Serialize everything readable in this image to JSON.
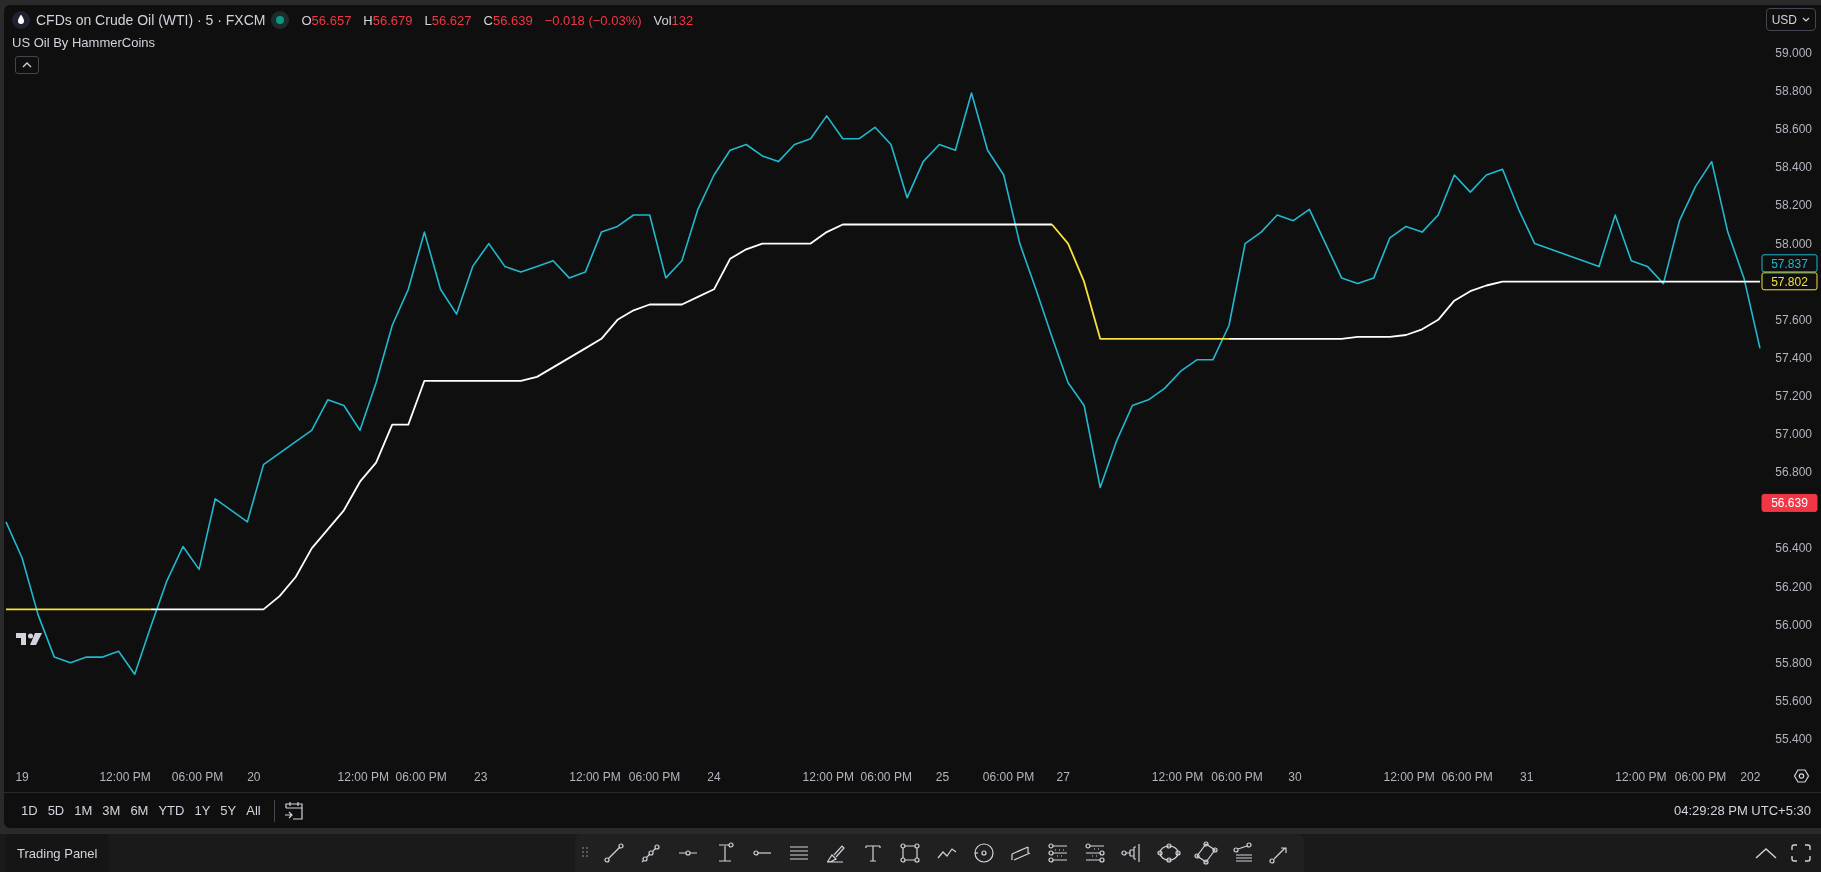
{
  "legend": {
    "title": "CFDs on Crude Oil (WTI) · 5 · FXCM",
    "market_open": true,
    "ohlc": [
      {
        "label": "O",
        "value": "56.657"
      },
      {
        "label": "H",
        "value": "56.679"
      },
      {
        "label": "L",
        "value": "56.627"
      },
      {
        "label": "C",
        "value": "56.639"
      }
    ],
    "change": "−0.018 (−0.03%)",
    "volume_label": "Vol",
    "volume": "132",
    "indicator": "US Oil By HammerCoins",
    "collapsed": false
  },
  "currency": "USD",
  "chart": {
    "chart_data": {
      "type": "line",
      "ylim": [
        55.4,
        59.0
      ],
      "yticks": [
        {
          "value": 59.0,
          "label": "59.000"
        },
        {
          "value": 58.8,
          "label": "58.800"
        },
        {
          "value": 58.6,
          "label": "58.600"
        },
        {
          "value": 58.4,
          "label": "58.400"
        },
        {
          "value": 58.2,
          "label": "58.200"
        },
        {
          "value": 58.0,
          "label": "58.000"
        },
        {
          "value": 57.6,
          "label": "57.600"
        },
        {
          "value": 57.4,
          "label": "57.400"
        },
        {
          "value": 57.2,
          "label": "57.200"
        },
        {
          "value": 57.0,
          "label": "57.000"
        },
        {
          "value": 56.8,
          "label": "56.800"
        },
        {
          "value": 56.4,
          "label": "56.400"
        },
        {
          "value": 56.2,
          "label": "56.200"
        },
        {
          "value": 56.0,
          "label": "56.000"
        },
        {
          "value": 55.8,
          "label": "55.800"
        },
        {
          "value": 55.6,
          "label": "55.600"
        },
        {
          "value": 55.4,
          "label": "55.400"
        }
      ],
      "series": [
        {
          "color": "#22b8cf",
          "values": [
            56.54,
            56.35,
            56.05,
            55.83,
            55.8,
            55.83,
            55.83,
            55.86,
            55.74,
            55.99,
            56.23,
            56.41,
            56.29,
            56.66,
            56.6,
            56.54,
            56.84,
            56.9,
            56.96,
            57.02,
            57.18,
            57.15,
            57.02,
            57.27,
            57.57,
            57.76,
            58.06,
            57.76,
            57.63,
            57.88,
            58.0,
            57.88,
            57.85,
            57.88,
            57.91,
            57.82,
            57.85,
            58.06,
            58.09,
            58.15,
            58.15,
            57.82,
            57.91,
            58.18,
            58.36,
            58.49,
            58.52,
            58.46,
            58.43,
            58.52,
            58.55,
            58.67,
            58.55,
            58.55,
            58.61,
            58.52,
            58.24,
            58.43,
            58.52,
            58.49,
            58.79,
            58.49,
            58.36,
            58.0,
            57.76,
            57.51,
            57.27,
            57.15,
            56.72,
            56.96,
            57.15,
            57.18,
            57.24,
            57.33,
            57.39,
            57.39,
            57.57,
            58.0,
            58.06,
            58.15,
            58.12,
            58.18,
            58.0,
            57.82,
            57.79,
            57.82,
            58.03,
            58.09,
            58.06,
            58.15,
            58.36,
            58.27,
            58.36,
            58.39,
            58.18,
            58.0,
            57.97,
            57.94,
            57.91,
            57.88,
            58.15,
            57.91,
            57.88,
            57.79,
            58.12,
            58.3,
            58.43,
            58.06,
            57.82,
            57.45
          ]
        },
        {
          "color": "#ffffff",
          "values": [
            null,
            null,
            null,
            null,
            null,
            null,
            null,
            null,
            null,
            56.08,
            56.08,
            56.08,
            56.08,
            56.08,
            56.08,
            56.08,
            56.08,
            56.15,
            56.25,
            56.4,
            56.5,
            56.6,
            56.75,
            56.85,
            57.05,
            57.05,
            57.28,
            57.28,
            57.28,
            57.28,
            57.28,
            57.28,
            57.28,
            57.3,
            57.35,
            57.4,
            57.45,
            57.5,
            57.6,
            57.65,
            57.68,
            57.68,
            57.68,
            57.72,
            57.76,
            57.92,
            57.97,
            58.0,
            58.0,
            58.0,
            58.0,
            58.06,
            58.1,
            58.1,
            58.1,
            58.1,
            58.1,
            58.1,
            58.1,
            58.1,
            58.1,
            58.1,
            58.1,
            58.1,
            58.1,
            58.1,
            null,
            null,
            null,
            null,
            null,
            null,
            null,
            null,
            null,
            null,
            57.5,
            57.5,
            57.5,
            57.5,
            57.5,
            57.5,
            57.5,
            57.5,
            57.51,
            57.51,
            57.51,
            57.52,
            57.55,
            57.6,
            57.7,
            57.75,
            57.78,
            57.8,
            57.8,
            57.8,
            57.8,
            57.8,
            57.8,
            57.8,
            57.8,
            57.8,
            57.8,
            57.8,
            57.8,
            57.8,
            57.8,
            57.8,
            57.8,
            57.8
          ]
        },
        {
          "color": "#f5e13a",
          "values": [
            56.08,
            56.08,
            56.08,
            56.08,
            56.08,
            56.08,
            56.08,
            56.08,
            56.08,
            56.08,
            null,
            null,
            null,
            null,
            null,
            null,
            null,
            null,
            null,
            null,
            null,
            null,
            null,
            null,
            null,
            null,
            null,
            null,
            null,
            null,
            null,
            null,
            null,
            null,
            null,
            null,
            null,
            null,
            null,
            null,
            null,
            null,
            null,
            null,
            null,
            null,
            null,
            null,
            null,
            null,
            null,
            null,
            null,
            null,
            null,
            null,
            null,
            null,
            null,
            null,
            null,
            null,
            null,
            null,
            null,
            58.1,
            58.0,
            57.8,
            57.5,
            57.5,
            57.5,
            57.5,
            57.5,
            57.5,
            57.5,
            57.5,
            57.5,
            null,
            null,
            null,
            null,
            null,
            null,
            null,
            null,
            null,
            null,
            null,
            null,
            null,
            null,
            null,
            null,
            null,
            null,
            null,
            null,
            null,
            null,
            null,
            null,
            null,
            null,
            null,
            null,
            null,
            null,
            null,
            null,
            null
          ]
        }
      ]
    },
    "time_axis": [
      "19",
      "12:00 PM",
      "06:00 PM",
      "20",
      "12:00 PM",
      "06:00 PM",
      "23",
      "12:00 PM",
      "06:00 PM",
      "24",
      "12:00 PM",
      "06:00 PM",
      "25",
      "06:00 PM",
      "27",
      "12:00 PM",
      "06:00 PM",
      "30",
      "12:00 PM",
      "06:00 PM",
      "31",
      "12:00 PM",
      "06:00 PM",
      "202"
    ],
    "price_markers": [
      {
        "value": "57.837",
        "color": "#22b8cf",
        "kind": "outline"
      },
      {
        "value": "57.802",
        "color": "#f5e13a",
        "kind": "outline"
      },
      {
        "value": "56.639",
        "color": "#f23645",
        "kind": "filled"
      }
    ]
  },
  "range_buttons": [
    "1D",
    "5D",
    "1M",
    "3M",
    "6M",
    "YTD",
    "1Y",
    "5Y",
    "All"
  ],
  "clock": "04:29:28 PM UTC+5:30",
  "bottom_panel": {
    "tab": "Trading Panel"
  }
}
